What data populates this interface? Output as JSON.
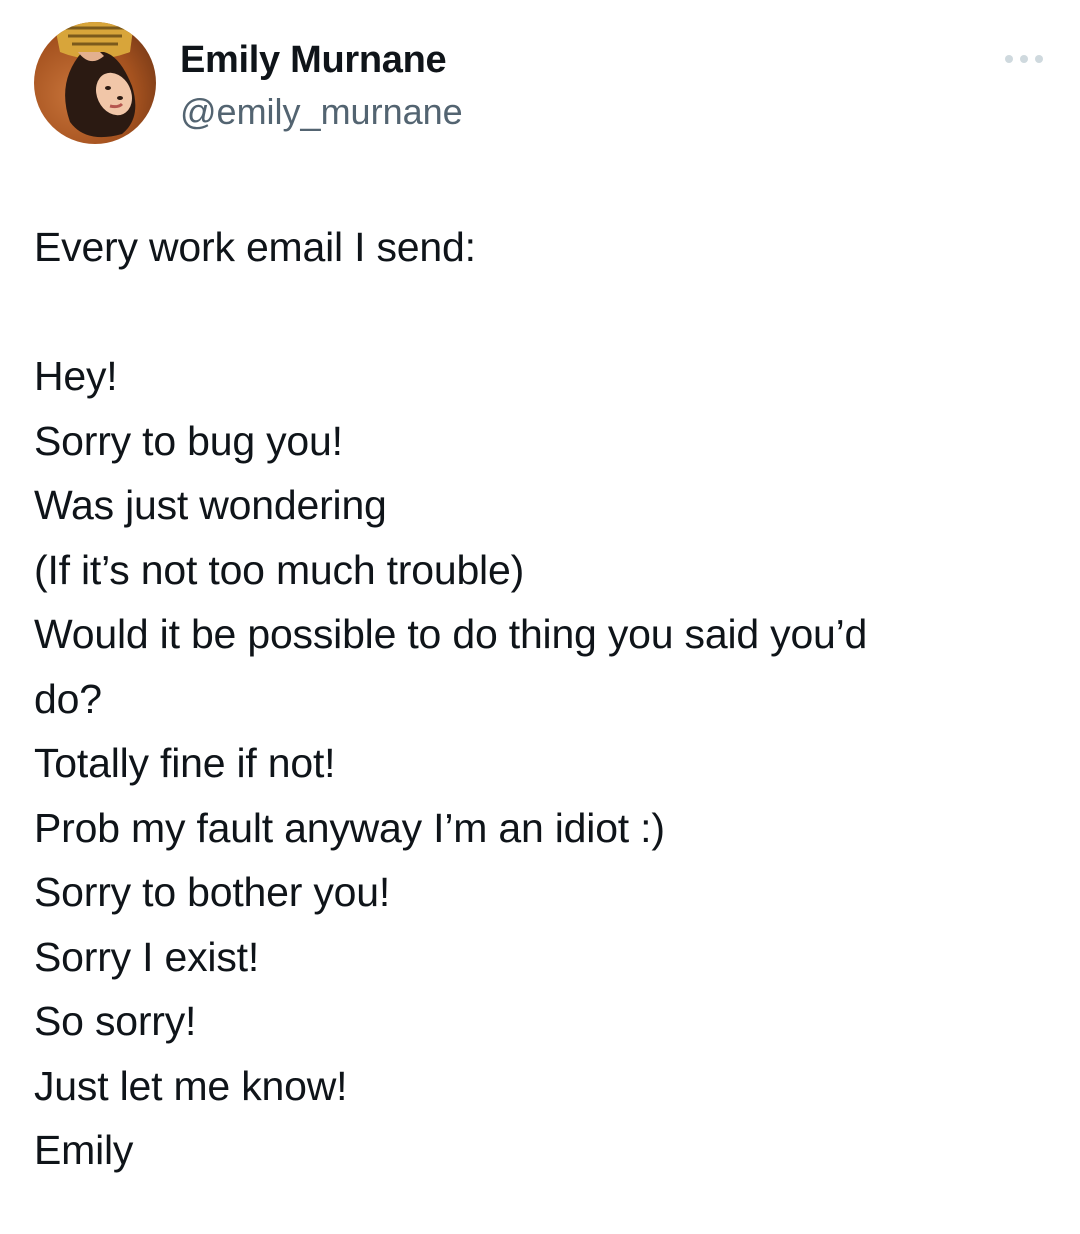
{
  "author": {
    "display_name": "Emily Murnane",
    "handle": "@emily_murnane",
    "avatar_icon": "profile-photo-avatar"
  },
  "menu": {
    "icon": "more-options-icon"
  },
  "tweet": {
    "intro": "Every work email I send:",
    "lines": [
      "Hey!",
      "Sorry to bug you!",
      "Was just wondering",
      "(If it’s not too much trouble)",
      "Would it be possible to do thing you said you’d",
      "do?",
      "Totally fine if not!",
      "Prob my fault anyway I’m an idiot :)",
      "Sorry to bother you!",
      "Sorry I exist!",
      "So sorry!",
      "Just let me know!",
      "Emily"
    ]
  },
  "colors": {
    "text_primary": "#0f1419",
    "text_secondary": "#536471",
    "background": "#ffffff"
  }
}
